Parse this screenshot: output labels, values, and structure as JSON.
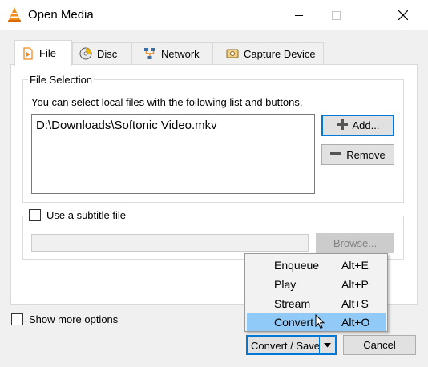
{
  "window": {
    "title": "Open Media",
    "icon": "vlc-cone-icon"
  },
  "tabs": [
    {
      "label": "File",
      "icon": "file-play-icon",
      "active": true
    },
    {
      "label": "Disc",
      "icon": "disc-icon",
      "active": false
    },
    {
      "label": "Network",
      "icon": "network-icon",
      "active": false
    },
    {
      "label": "Capture Device",
      "icon": "capture-device-icon",
      "active": false
    }
  ],
  "file_selection": {
    "group_title": "File Selection",
    "instructions": "You can select local files with the following list and buttons.",
    "files": [
      "D:\\Downloads\\Softonic Video.mkv"
    ],
    "add_label": "Add...",
    "remove_label": "Remove"
  },
  "subtitle": {
    "checkbox_label": "Use a subtitle file",
    "checked": false,
    "path_value": "",
    "browse_label": "Browse..."
  },
  "footer": {
    "show_more_label": "Show more options",
    "show_more_checked": false,
    "convert_save_label": "Convert / Save",
    "cancel_label": "Cancel"
  },
  "menu": {
    "items": [
      {
        "label": "Enqueue",
        "shortcut": "Alt+E",
        "highlighted": false
      },
      {
        "label": "Play",
        "shortcut": "Alt+P",
        "highlighted": false
      },
      {
        "label": "Stream",
        "shortcut": "Alt+S",
        "highlighted": false
      },
      {
        "label": "Convert",
        "shortcut": "Alt+O",
        "highlighted": true
      }
    ]
  },
  "colors": {
    "accent": "#0078d7",
    "highlight": "#91c9f7",
    "vlc_orange": "#f08c1c"
  }
}
